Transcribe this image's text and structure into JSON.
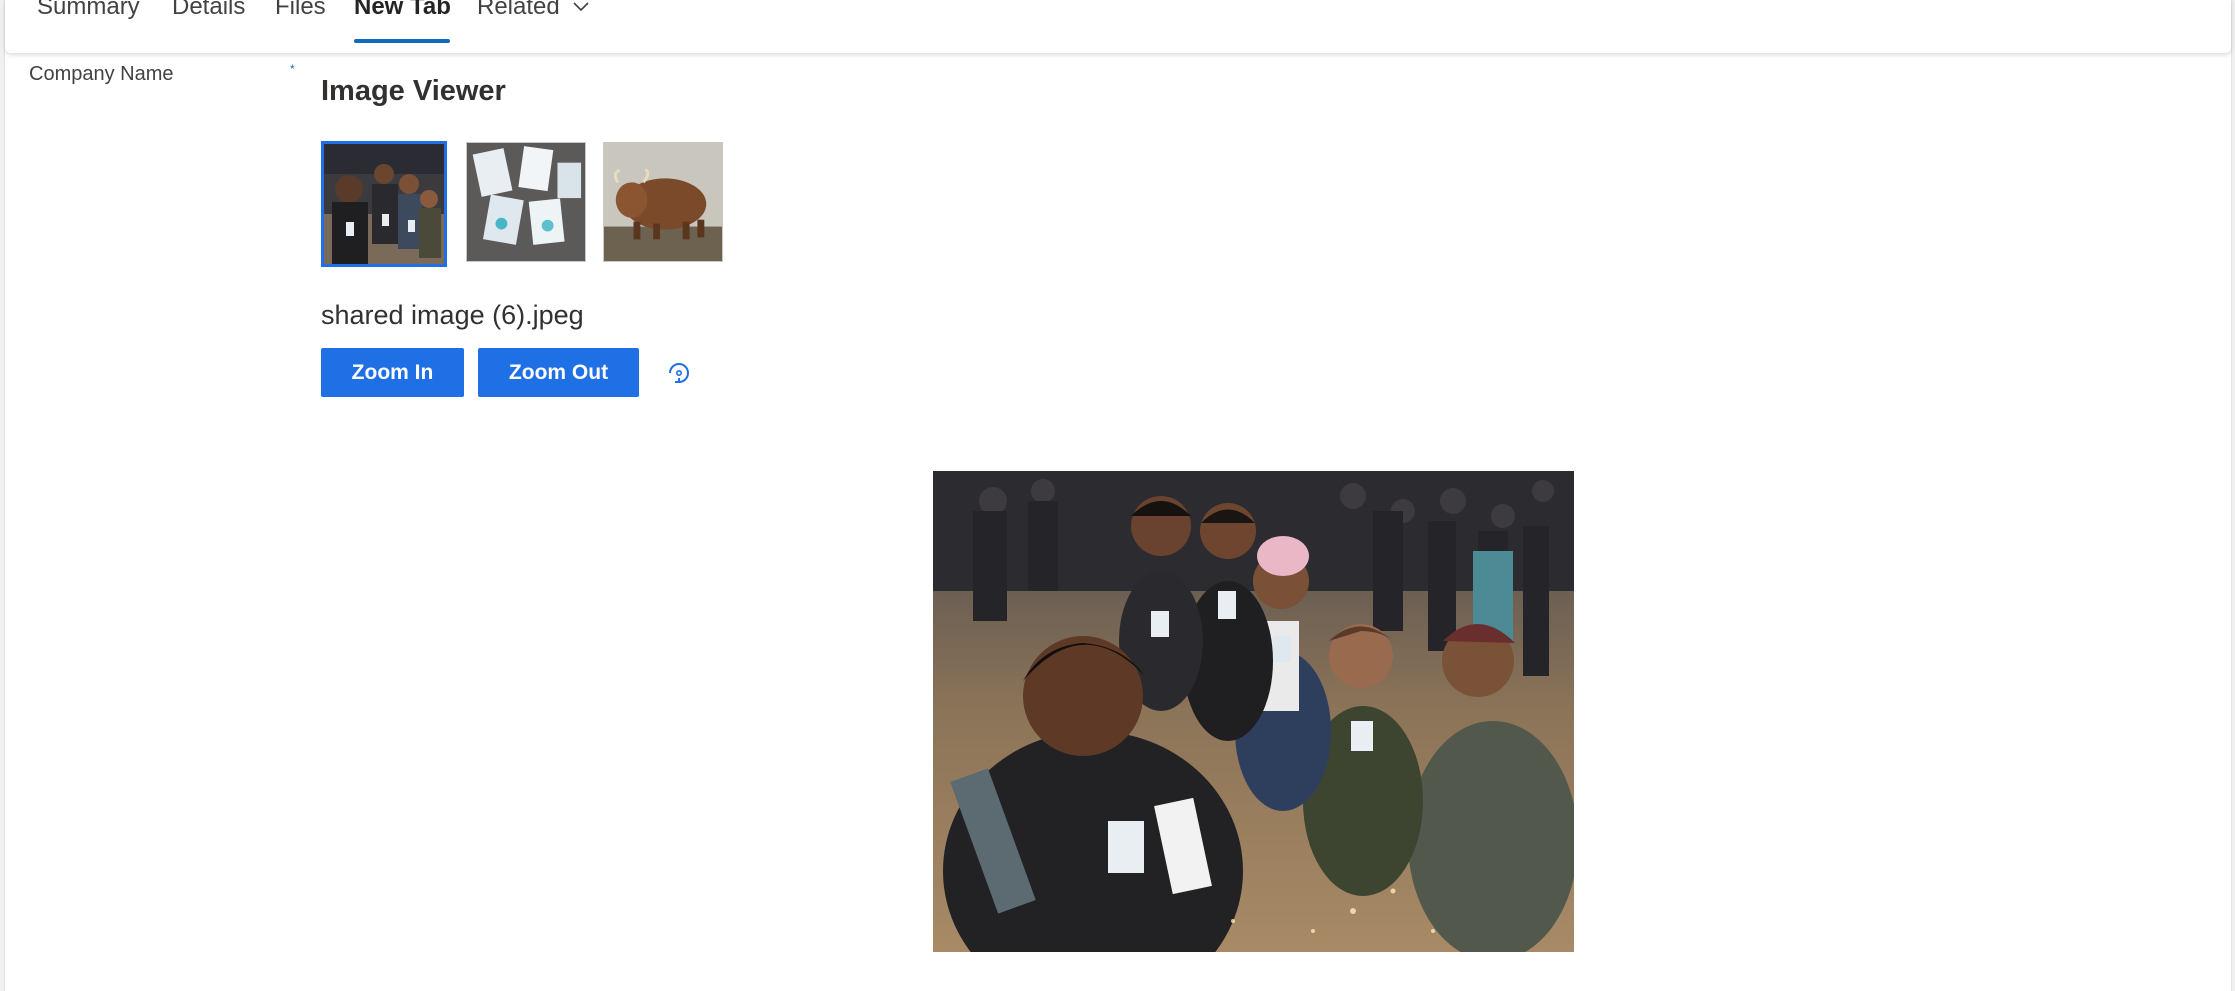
{
  "tabs": [
    {
      "label": "Summary"
    },
    {
      "label": "Details"
    },
    {
      "label": "Files"
    },
    {
      "label": "New Tab",
      "active": true
    },
    {
      "label": "Related"
    }
  ],
  "form": {
    "company_label": "Company Name",
    "required_mark": "*"
  },
  "viewer": {
    "title": "Image Viewer",
    "thumbnails": [
      {
        "subject": "group selfie",
        "selected": true
      },
      {
        "subject": "badges on table",
        "selected": false
      },
      {
        "subject": "highland cow",
        "selected": false
      }
    ],
    "file_name": "shared image (6).jpeg",
    "zoom_in_label": "Zoom In",
    "zoom_out_label": "Zoom Out",
    "rotate_icon": "rotate-icon"
  },
  "colors": {
    "accent": "#1f6fe5",
    "tab_underline": "#0f6cbd",
    "button_text": "#ffffff"
  }
}
